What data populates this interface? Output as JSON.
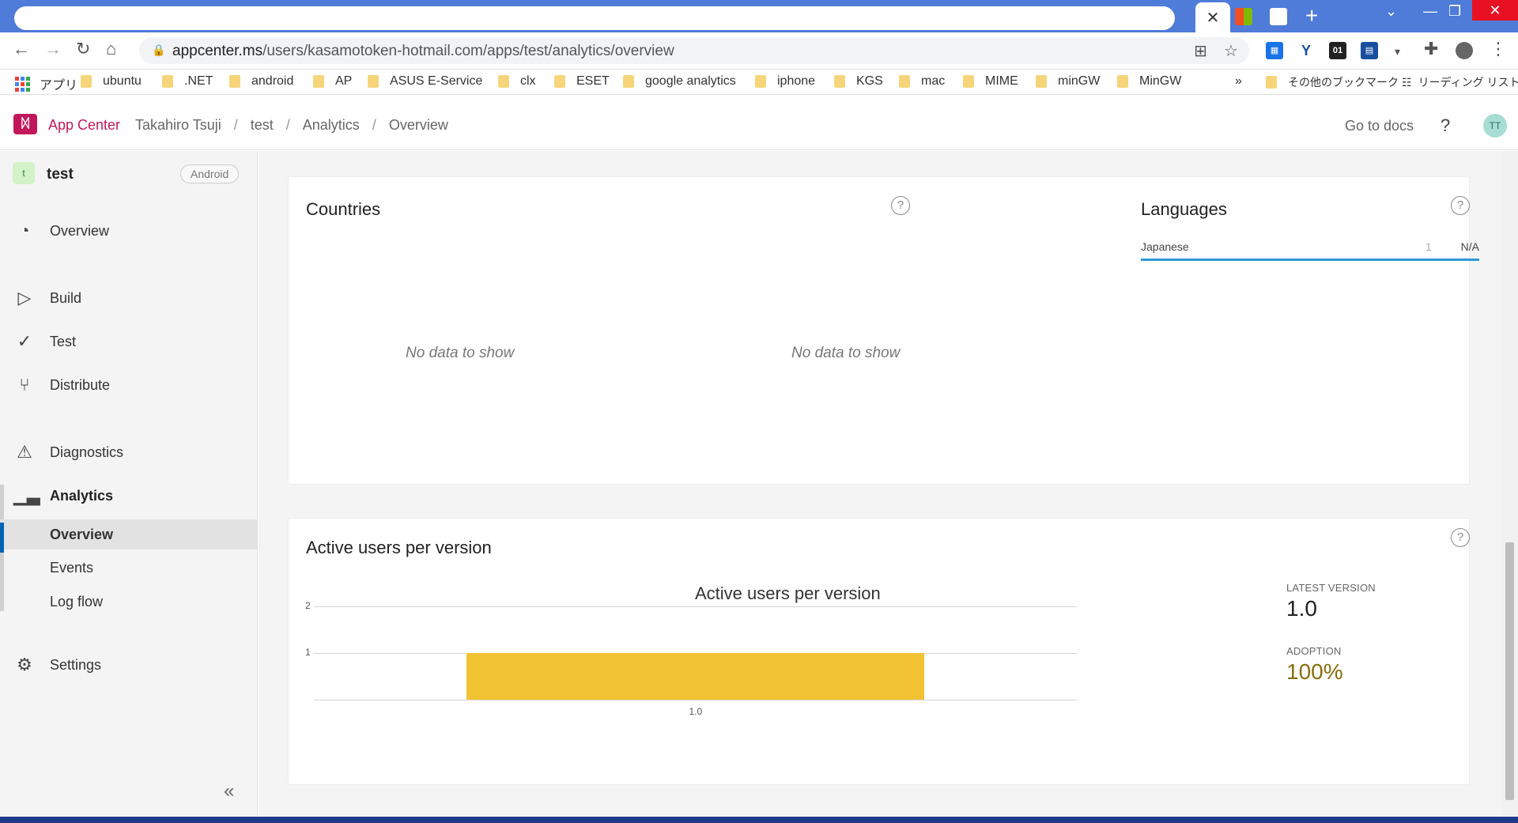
{
  "browser": {
    "url_host": "appcenter.ms",
    "url_path": "/users/kasamotoken-hotmail.com/apps/test/analytics/overview",
    "active_tab_close": "✕",
    "new_tab": "+",
    "bookmarks": [
      {
        "label": "アプリ",
        "type": "apps"
      },
      {
        "label": "ubuntu",
        "type": "folder"
      },
      {
        "label": ".NET",
        "type": "folder"
      },
      {
        "label": "android",
        "type": "folder"
      },
      {
        "label": "AP",
        "type": "folder"
      },
      {
        "label": "ASUS E-Service",
        "type": "folder"
      },
      {
        "label": "clx",
        "type": "folder"
      },
      {
        "label": "ESET",
        "type": "folder"
      },
      {
        "label": "google analytics",
        "type": "folder"
      },
      {
        "label": "iphone",
        "type": "folder"
      },
      {
        "label": "KGS",
        "type": "folder"
      },
      {
        "label": "mac",
        "type": "folder"
      },
      {
        "label": "MIME",
        "type": "folder"
      },
      {
        "label": "minGW",
        "type": "folder"
      },
      {
        "label": "MinGW",
        "type": "folder"
      }
    ],
    "bookmarks_overflow": "»",
    "other_bookmarks": "その他のブックマーク",
    "reading_list": "リーディング リスト"
  },
  "header": {
    "brand": "App Center",
    "breadcrumbs": [
      "Takahiro Tsuji",
      "test",
      "Analytics",
      "Overview"
    ],
    "go_to_docs": "Go to docs",
    "help": "?",
    "avatar_initials": "TT"
  },
  "sidebar": {
    "app_badge": "t",
    "app_name": "test",
    "platform": "Android",
    "items": [
      {
        "label": "Overview",
        "icon": "gauge-icon"
      },
      {
        "label": "Build",
        "icon": "play-icon"
      },
      {
        "label": "Test",
        "icon": "check-circle-icon"
      },
      {
        "label": "Distribute",
        "icon": "distribute-icon"
      },
      {
        "label": "Diagnostics",
        "icon": "warning-icon"
      },
      {
        "label": "Analytics",
        "icon": "bar-chart-icon"
      },
      {
        "label": "Settings",
        "icon": "gear-icon"
      }
    ],
    "analytics_sub": [
      "Overview",
      "Events",
      "Log flow"
    ],
    "collapse": "«"
  },
  "countries_card": {
    "title": "Countries",
    "no_data_left": "No data to show",
    "no_data_right": "No data to show",
    "help": "?"
  },
  "languages_card": {
    "title": "Languages",
    "help": "?",
    "rows": [
      {
        "name": "Japanese",
        "count": "1",
        "percent": "N/A"
      }
    ]
  },
  "versions_card": {
    "title": "Active users per version",
    "help": "?",
    "latest_version_label": "LATEST VERSION",
    "latest_version": "1.0",
    "adoption_label": "ADOPTION",
    "adoption": "100%"
  },
  "chart_data": {
    "type": "bar",
    "title": "Active users per version",
    "categories": [
      "1.0"
    ],
    "values": [
      1
    ],
    "ylim": [
      0,
      2
    ],
    "yticks": [
      "1",
      "2"
    ],
    "grid": true,
    "color": "#f1c232"
  },
  "colors": {
    "brand": "#c2185b",
    "accent": "#0063b1",
    "lang_bar": "#2a9bd6",
    "adoption": "#8a6d0b"
  }
}
